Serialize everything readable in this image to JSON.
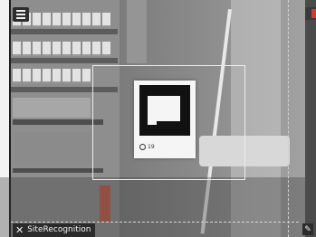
{
  "toolbar": {
    "menu_icon": "hamburger-menu-icon",
    "close_icon": "close-x-icon",
    "edit_icon": "edit-pencil-icon"
  },
  "app": {
    "name": "SiteRecognition",
    "close_glyph": "✕",
    "edit_glyph": "✎"
  },
  "marker": {
    "caption": "19"
  },
  "colors": {
    "overlay_dark": "#2b2b2b",
    "overlay_text": "#f2f2f2",
    "target_box": "#ececec",
    "accent_red": "#d23a3a"
  }
}
